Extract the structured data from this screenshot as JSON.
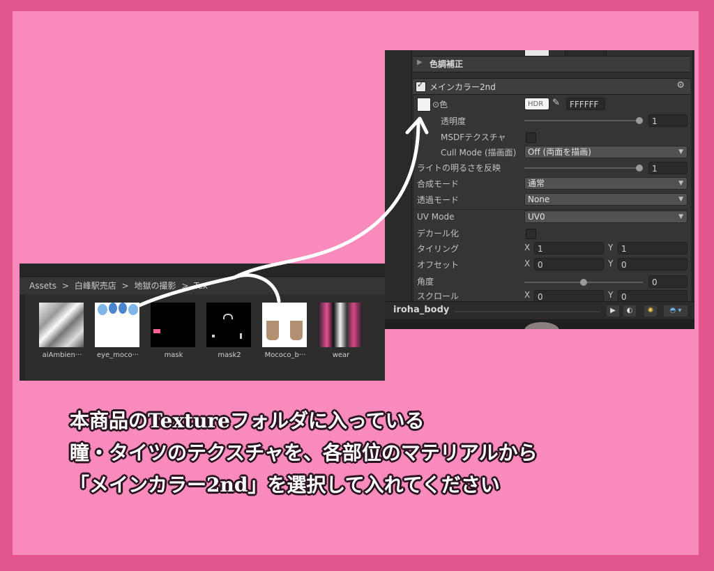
{
  "colors": {
    "outer_border": "#e2558d",
    "background": "#f98bbc",
    "panel": "#303030",
    "caption_text": "#ffffff",
    "caption_outline": "#2b1422"
  },
  "inspector": {
    "section_color_correction": "色調補正",
    "section_main_color_2nd": "メインカラー2nd",
    "gear_icon": "gear-icon",
    "color_label": "⊙色",
    "hdr_label": "HDR",
    "hex_value": "FFFFFF",
    "transparency_label": "透明度",
    "transparency_value": "1",
    "msdf_label": "MSDFテクスチャ",
    "cull_mode_label": "Cull Mode (描画面)",
    "cull_mode_value": "Off (両面を描画)",
    "light_invert_label": "ライトの明るさを反映",
    "light_invert_value": "1",
    "blend_mode_label": "合成モード",
    "blend_mode_value": "通常",
    "transparency_mode_label": "透過モード",
    "transparency_mode_value": "None",
    "uv_mode_label": "UV Mode",
    "uv_mode_value": "UV0",
    "decal_label": "デカール化",
    "tiling_label": "タイリング",
    "tiling_x_label": "X",
    "tiling_x": "1",
    "tiling_y_label": "Y",
    "tiling_y": "1",
    "offset_label": "オフセット",
    "offset_x_label": "X",
    "offset_x": "0",
    "offset_y_label": "Y",
    "offset_y": "0",
    "angle_label": "角度",
    "angle_value": "0",
    "scroll_label": "スクロール",
    "scroll_x_label": "X",
    "scroll_x": "0",
    "scroll_y_label": "Y",
    "scroll_y": "0",
    "preview_object": "iroha_body",
    "slider_levels": {
      "transparency": 1.0,
      "light_invert": 1.0,
      "angle": 0.5
    }
  },
  "project": {
    "breadcrumb": [
      "Assets",
      ">",
      "白峰駅売店",
      ">",
      "地獄の撮影",
      ">",
      "Tex"
    ],
    "thumbnails": [
      {
        "label": "aiAmbien···",
        "icon": "texture-gray-icon"
      },
      {
        "label": "eye_moco···",
        "icon": "texture-eyes-icon"
      },
      {
        "label": "mask",
        "icon": "texture-mask-icon"
      },
      {
        "label": "mask2",
        "icon": "texture-mask2-icon"
      },
      {
        "label": "Mococo_b···",
        "icon": "texture-tights-icon"
      },
      {
        "label": "wear",
        "icon": "texture-wear-icon"
      }
    ]
  },
  "caption": {
    "line1": "本商品のTextureフォルダに入っている",
    "line2": "瞳・タイツのテクスチャを、各部位のマテリアルから",
    "line3": "「メインカラー2nd」を選択して入れてください"
  }
}
